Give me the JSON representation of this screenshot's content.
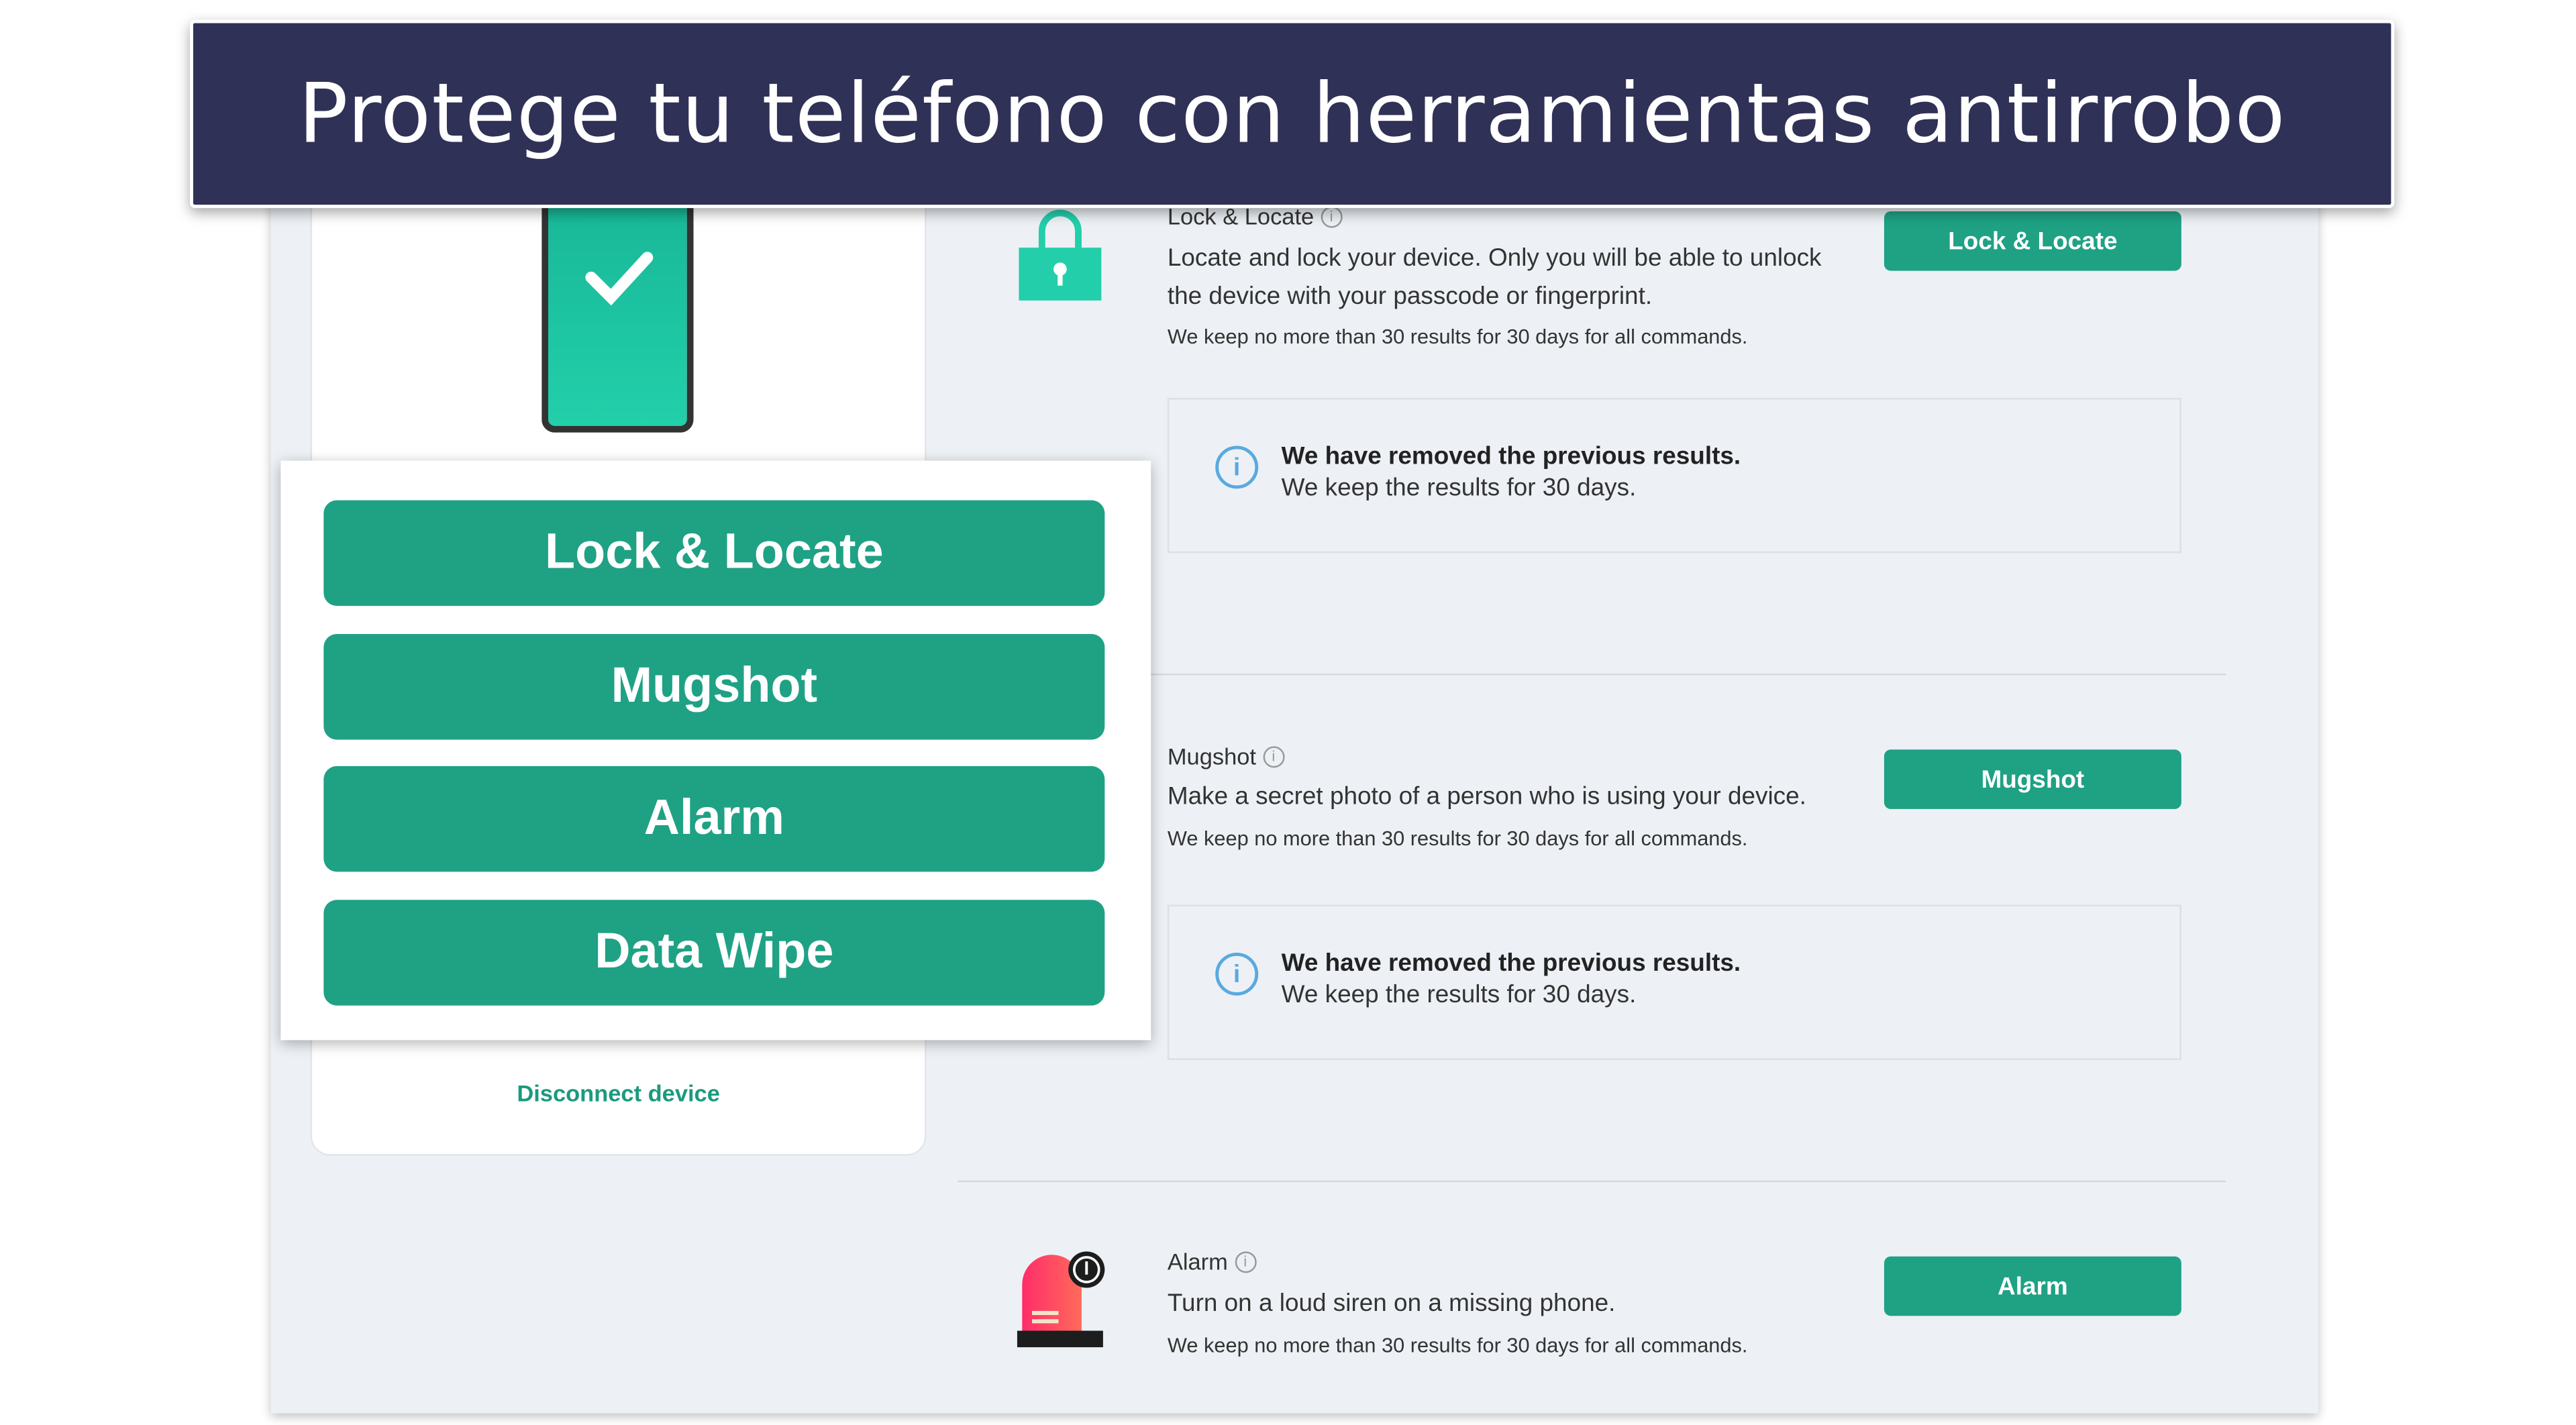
{
  "banner": {
    "title": "Protege tu teléfono con herramientas antirrobo"
  },
  "overlay": {
    "buttons": [
      "Lock & Locate",
      "Mugshot",
      "Alarm",
      "Data Wipe"
    ]
  },
  "left_card": {
    "disconnect_label": "Disconnect device"
  },
  "sections": [
    {
      "title": "Lock & Locate",
      "description_line1": "Locate and lock your device. Only you will be able to unlock",
      "description_line2": "the device with your passcode or fingerprint.",
      "note": "We keep no more than 30 results for 30 days for all commands.",
      "button": "Lock & Locate",
      "info_bold": "We have removed the previous results.",
      "info_text": "We keep the results for 30 days."
    },
    {
      "title": "Mugshot",
      "description_line1": "Make a secret photo of a person who is using your device.",
      "note": "We keep no more than 30 results for 30 days for all commands.",
      "button": "Mugshot",
      "info_bold": "We have removed the previous results.",
      "info_text": "We keep the results for 30 days."
    },
    {
      "title": "Alarm",
      "description_line1": "Turn on a loud siren on a missing phone.",
      "note": "We keep no more than 30 results for 30 days for all commands.",
      "button": "Alarm"
    }
  ],
  "colors": {
    "accent": "#1fa184",
    "banner_bg": "#2f3157",
    "panel_bg": "#edf1f5",
    "info_blue": "#5aa9e0"
  }
}
